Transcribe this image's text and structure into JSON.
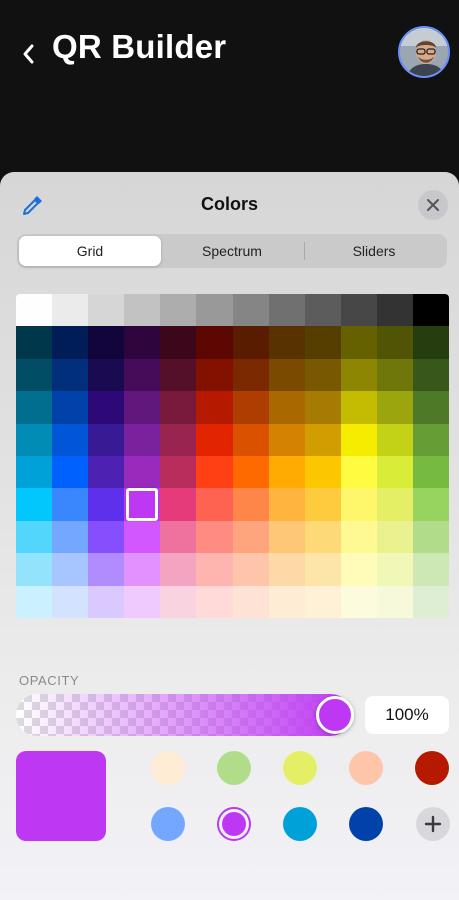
{
  "header": {
    "title": "QR Builder"
  },
  "sheet": {
    "title": "Colors",
    "tabs": [
      {
        "label": "Grid",
        "active": true
      },
      {
        "label": "Spectrum",
        "active": false
      },
      {
        "label": "Sliders",
        "active": false
      }
    ]
  },
  "grid": {
    "rows": [
      [
        "#FEFEFE",
        "#EBEBEB",
        "#D6D6D6",
        "#C2C2C2",
        "#ADADAD",
        "#999999",
        "#858585",
        "#707070",
        "#5C5C5C",
        "#474747",
        "#333333",
        "#000000"
      ],
      [
        "#00374A",
        "#011D57",
        "#11053B",
        "#2E063D",
        "#3C071B",
        "#5C0701",
        "#5A1C00",
        "#583300",
        "#563D00",
        "#666100",
        "#4F5504",
        "#263E0F"
      ],
      [
        "#004D65",
        "#012F7B",
        "#1A0A52",
        "#450D59",
        "#551029",
        "#831100",
        "#7B2900",
        "#7A4A00",
        "#785800",
        "#8C8602",
        "#6F760A",
        "#38571A"
      ],
      [
        "#016E8F",
        "#0042A9",
        "#2C0977",
        "#61187C",
        "#791A3D",
        "#B51A00",
        "#AD3E00",
        "#A96800",
        "#A67B01",
        "#C4BC00",
        "#9BA50E",
        "#4E7A27"
      ],
      [
        "#008CB4",
        "#0056D6",
        "#371A94",
        "#7A219E",
        "#99244F",
        "#E22400",
        "#DA5100",
        "#D38301",
        "#D19D01",
        "#F5EC00",
        "#C3D117",
        "#669D34"
      ],
      [
        "#00A1D8",
        "#0061FE",
        "#4D22B2",
        "#982ABC",
        "#B92D5D",
        "#FF4015",
        "#FF6A00",
        "#FFAB01",
        "#FCC700",
        "#FEFB41",
        "#D9EC37",
        "#76BB40"
      ],
      [
        "#01C7FC",
        "#3A87FD",
        "#5E30EB",
        "#BE38F3",
        "#E63B7A",
        "#FE6250",
        "#FE8648",
        "#FEB43F",
        "#FECB3E",
        "#FFF76B",
        "#E4EF65",
        "#96D35F"
      ],
      [
        "#52D6FC",
        "#74A7FF",
        "#864FFE",
        "#D357FE",
        "#EE719E",
        "#FF8C82",
        "#FEA57D",
        "#FEC777",
        "#FED977",
        "#FFF994",
        "#EAF28F",
        "#B1DD8B"
      ],
      [
        "#93E3FC",
        "#A7C6FF",
        "#B18CFE",
        "#E292FE",
        "#F4A4C0",
        "#FFB5AF",
        "#FFC5AB",
        "#FED9A8",
        "#FDE4A8",
        "#FFFBB9",
        "#F1F7B7",
        "#CDE8B5"
      ],
      [
        "#CBF0FF",
        "#D3E2FF",
        "#D9C9FE",
        "#EFCAFE",
        "#F9D3E0",
        "#FFDAD8",
        "#FFE2D6",
        "#FEECD4",
        "#FEF1D5",
        "#FDFBDD",
        "#F6FADB",
        "#DEEED4"
      ]
    ],
    "selected": {
      "row": 6,
      "col": 3
    }
  },
  "opacity": {
    "label": "OPACITY",
    "value": "100%",
    "level": 1.0,
    "color": "#BE38F3"
  },
  "current_color": "#BE38F3",
  "swatches": [
    [
      "#FEECD4",
      "#B1DD8B",
      "#E4EF65",
      "#FFC5AB",
      "#B51A00"
    ],
    [
      "#74A7FF",
      "#BE38F3",
      "#00A1D8",
      "#0042A9"
    ]
  ],
  "selected_swatch": {
    "row": 1,
    "col": 1
  },
  "icons": {
    "back": "chevron-left-icon",
    "eyedropper": "eyedropper-icon",
    "close": "close-icon",
    "add": "plus-icon"
  },
  "colors": {
    "accent": "#BE38F3",
    "header_bg": "#111111",
    "avatar_ring": "#6A8DFF"
  }
}
